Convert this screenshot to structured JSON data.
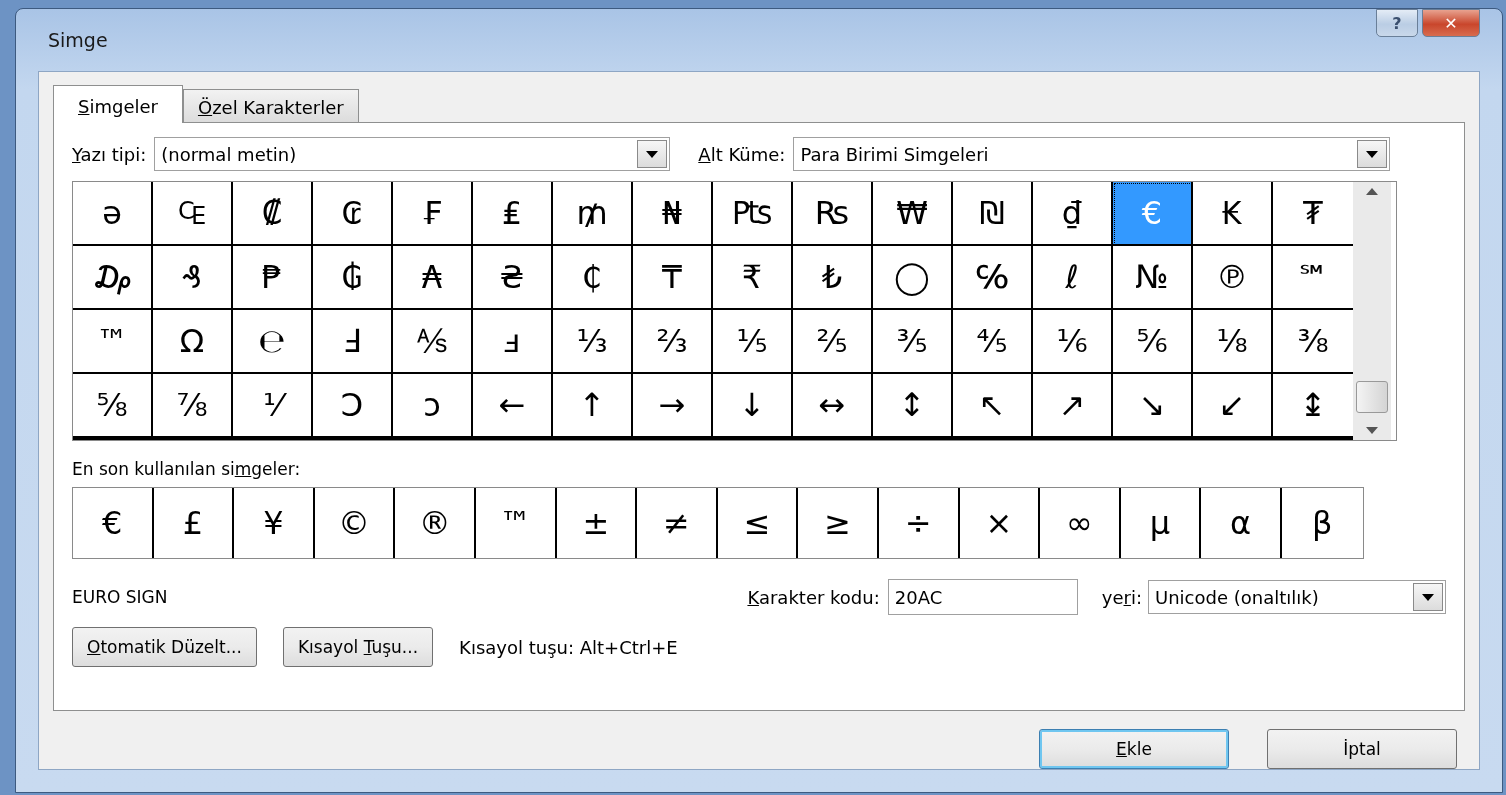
{
  "window": {
    "title": "Simge",
    "buttons": [
      {
        "kind": "help",
        "label": "?"
      },
      {
        "kind": "close",
        "label": "✕"
      }
    ]
  },
  "tabs": [
    {
      "label": {
        "key": "S",
        "after": "imgeler"
      },
      "selected": true
    },
    {
      "label": {
        "key": "Ö",
        "after": "zel Karakterler"
      },
      "selected": false
    }
  ],
  "font_select": {
    "label": {
      "key": "Y",
      "after": "azı tipi:"
    },
    "value": "(normal metin)"
  },
  "subset_select": {
    "label": {
      "key": "A",
      "after": "lt Küme:"
    },
    "value": "Para Birimi Simgeleri"
  },
  "symbol_grid": [
    [
      {
        "char": "ə",
        "selected": false
      },
      {
        "char": "₠",
        "selected": false
      },
      {
        "char": "₡",
        "selected": false
      },
      {
        "char": "₢",
        "selected": false
      },
      {
        "char": "₣",
        "selected": false
      },
      {
        "char": "₤",
        "selected": false
      },
      {
        "char": "₥",
        "selected": false
      },
      {
        "char": "₦",
        "selected": false
      },
      {
        "char": "₧",
        "selected": false
      },
      {
        "char": "₨",
        "selected": false
      },
      {
        "char": "₩",
        "selected": false
      },
      {
        "char": "₪",
        "selected": false
      },
      {
        "char": "₫",
        "selected": false
      },
      {
        "char": "€",
        "selected": true
      },
      {
        "char": "₭",
        "selected": false
      },
      {
        "char": "₮",
        "selected": false
      }
    ],
    [
      {
        "char": "₯",
        "selected": false
      },
      {
        "char": "₰",
        "selected": false
      },
      {
        "char": "₱",
        "selected": false
      },
      {
        "char": "₲",
        "selected": false
      },
      {
        "char": "₳",
        "selected": false
      },
      {
        "char": "₴",
        "selected": false
      },
      {
        "char": "₵",
        "selected": false
      },
      {
        "char": "₸",
        "selected": false
      },
      {
        "char": "₹",
        "selected": false
      },
      {
        "char": "₺",
        "selected": false
      },
      {
        "char": "◯",
        "selected": false
      },
      {
        "char": "℅",
        "selected": false
      },
      {
        "char": "ℓ",
        "selected": false
      },
      {
        "char": "№",
        "selected": false
      },
      {
        "char": "℗",
        "selected": false
      },
      {
        "char": "℠",
        "selected": false
      }
    ],
    [
      {
        "char": "™",
        "selected": false
      },
      {
        "char": "Ω",
        "selected": false
      },
      {
        "char": "℮",
        "selected": false
      },
      {
        "char": "Ⅎ",
        "selected": false
      },
      {
        "char": "⅍",
        "selected": false
      },
      {
        "char": "ⅎ",
        "selected": false
      },
      {
        "char": "⅓",
        "selected": false
      },
      {
        "char": "⅔",
        "selected": false
      },
      {
        "char": "⅕",
        "selected": false
      },
      {
        "char": "⅖",
        "selected": false
      },
      {
        "char": "⅗",
        "selected": false
      },
      {
        "char": "⅘",
        "selected": false
      },
      {
        "char": "⅙",
        "selected": false
      },
      {
        "char": "⅚",
        "selected": false
      },
      {
        "char": "⅛",
        "selected": false
      },
      {
        "char": "⅜",
        "selected": false
      }
    ],
    [
      {
        "char": "⅝",
        "selected": false
      },
      {
        "char": "⅞",
        "selected": false
      },
      {
        "char": "⅟",
        "selected": false
      },
      {
        "char": "Ↄ",
        "selected": false
      },
      {
        "char": "ↄ",
        "selected": false
      },
      {
        "char": "←",
        "selected": false
      },
      {
        "char": "↑",
        "selected": false
      },
      {
        "char": "→",
        "selected": false
      },
      {
        "char": "↓",
        "selected": false
      },
      {
        "char": "↔",
        "selected": false
      },
      {
        "char": "↕",
        "selected": false
      },
      {
        "char": "↖",
        "selected": false
      },
      {
        "char": "↗",
        "selected": false
      },
      {
        "char": "↘",
        "selected": false
      },
      {
        "char": "↙",
        "selected": false
      },
      {
        "char": "↨",
        "selected": false
      }
    ]
  ],
  "recent": {
    "label": {
      "before": "En son kullanılan si",
      "key": "m",
      "after": "geler:"
    },
    "symbols": [
      "€",
      "£",
      "¥",
      "©",
      "®",
      "™",
      "±",
      "≠",
      "≤",
      "≥",
      "÷",
      "×",
      "∞",
      "µ",
      "α",
      "β"
    ]
  },
  "character_name": "EURO SIGN",
  "char_code": {
    "label": {
      "key": "K",
      "after": "arakter kodu:"
    },
    "value": "20AC"
  },
  "from_select": {
    "label": {
      "before": "ye",
      "key": "r",
      "after": "i:"
    },
    "value": "Unicode (onaltılık)"
  },
  "autocorrect_button": {
    "key": "O",
    "after": "tomatik Düzelt..."
  },
  "shortcut_button": {
    "before": "Kısayol ",
    "key": "T",
    "after": "uşu..."
  },
  "shortcut_text": "Kısayol tuşu: Alt+Ctrl+E",
  "footer_buttons": [
    {
      "label": {
        "key": "E",
        "after": "kle"
      },
      "default": true
    },
    {
      "label": {
        "before": "İptal"
      },
      "default": false
    }
  ]
}
